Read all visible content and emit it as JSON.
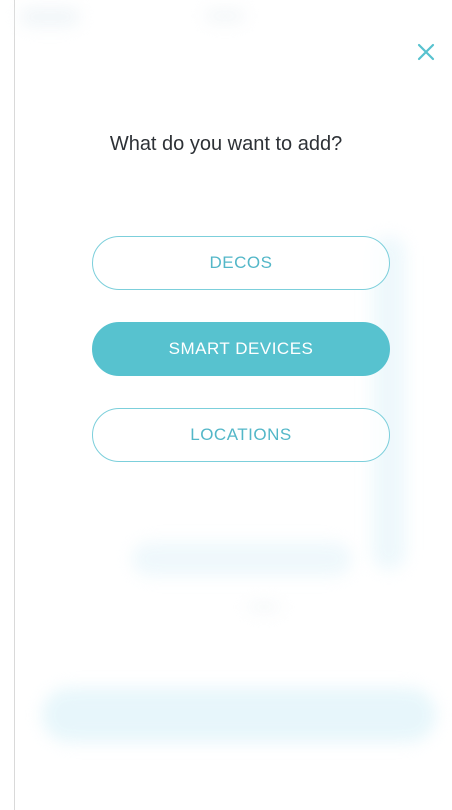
{
  "theme": {
    "accent": "#57C2CF",
    "accent_outline": "#7CCFDB",
    "title_text": "#2D3136",
    "background": "#FFFFFF"
  },
  "header": {
    "close_icon": "close-icon"
  },
  "main": {
    "title": "What do you want to add?",
    "options": [
      {
        "label": "DECOS",
        "selected": false
      },
      {
        "label": "SMART DEVICES",
        "selected": true
      },
      {
        "label": "LOCATIONS",
        "selected": false
      }
    ]
  }
}
